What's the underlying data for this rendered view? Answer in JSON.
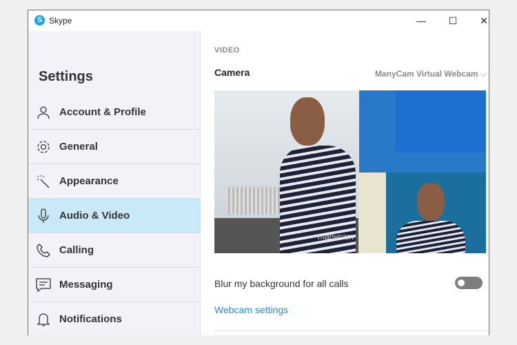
{
  "window": {
    "title": "Skype",
    "minimize": "—",
    "maximize": "☐",
    "close": "✕"
  },
  "sidebar": {
    "title": "Settings",
    "items": [
      {
        "label": "Account & Profile",
        "icon": "person-icon"
      },
      {
        "label": "General",
        "icon": "gear-icon"
      },
      {
        "label": "Appearance",
        "icon": "magic-wand-icon"
      },
      {
        "label": "Audio & Video",
        "icon": "microphone-icon",
        "active": true
      },
      {
        "label": "Calling",
        "icon": "phone-icon"
      },
      {
        "label": "Messaging",
        "icon": "message-icon"
      },
      {
        "label": "Notifications",
        "icon": "bell-icon"
      }
    ]
  },
  "main": {
    "section": "VIDEO",
    "camera_label": "Camera",
    "camera_value": "ManyCam Virtual Webcam",
    "watermark": "manycam",
    "blur_label": "Blur my background for all calls",
    "blur_enabled": false,
    "webcam_link": "Webcam settings"
  },
  "colors": {
    "accent": "#2b88d8",
    "active_bg": "#c9e8f8",
    "skype": "#1ea0e8"
  }
}
